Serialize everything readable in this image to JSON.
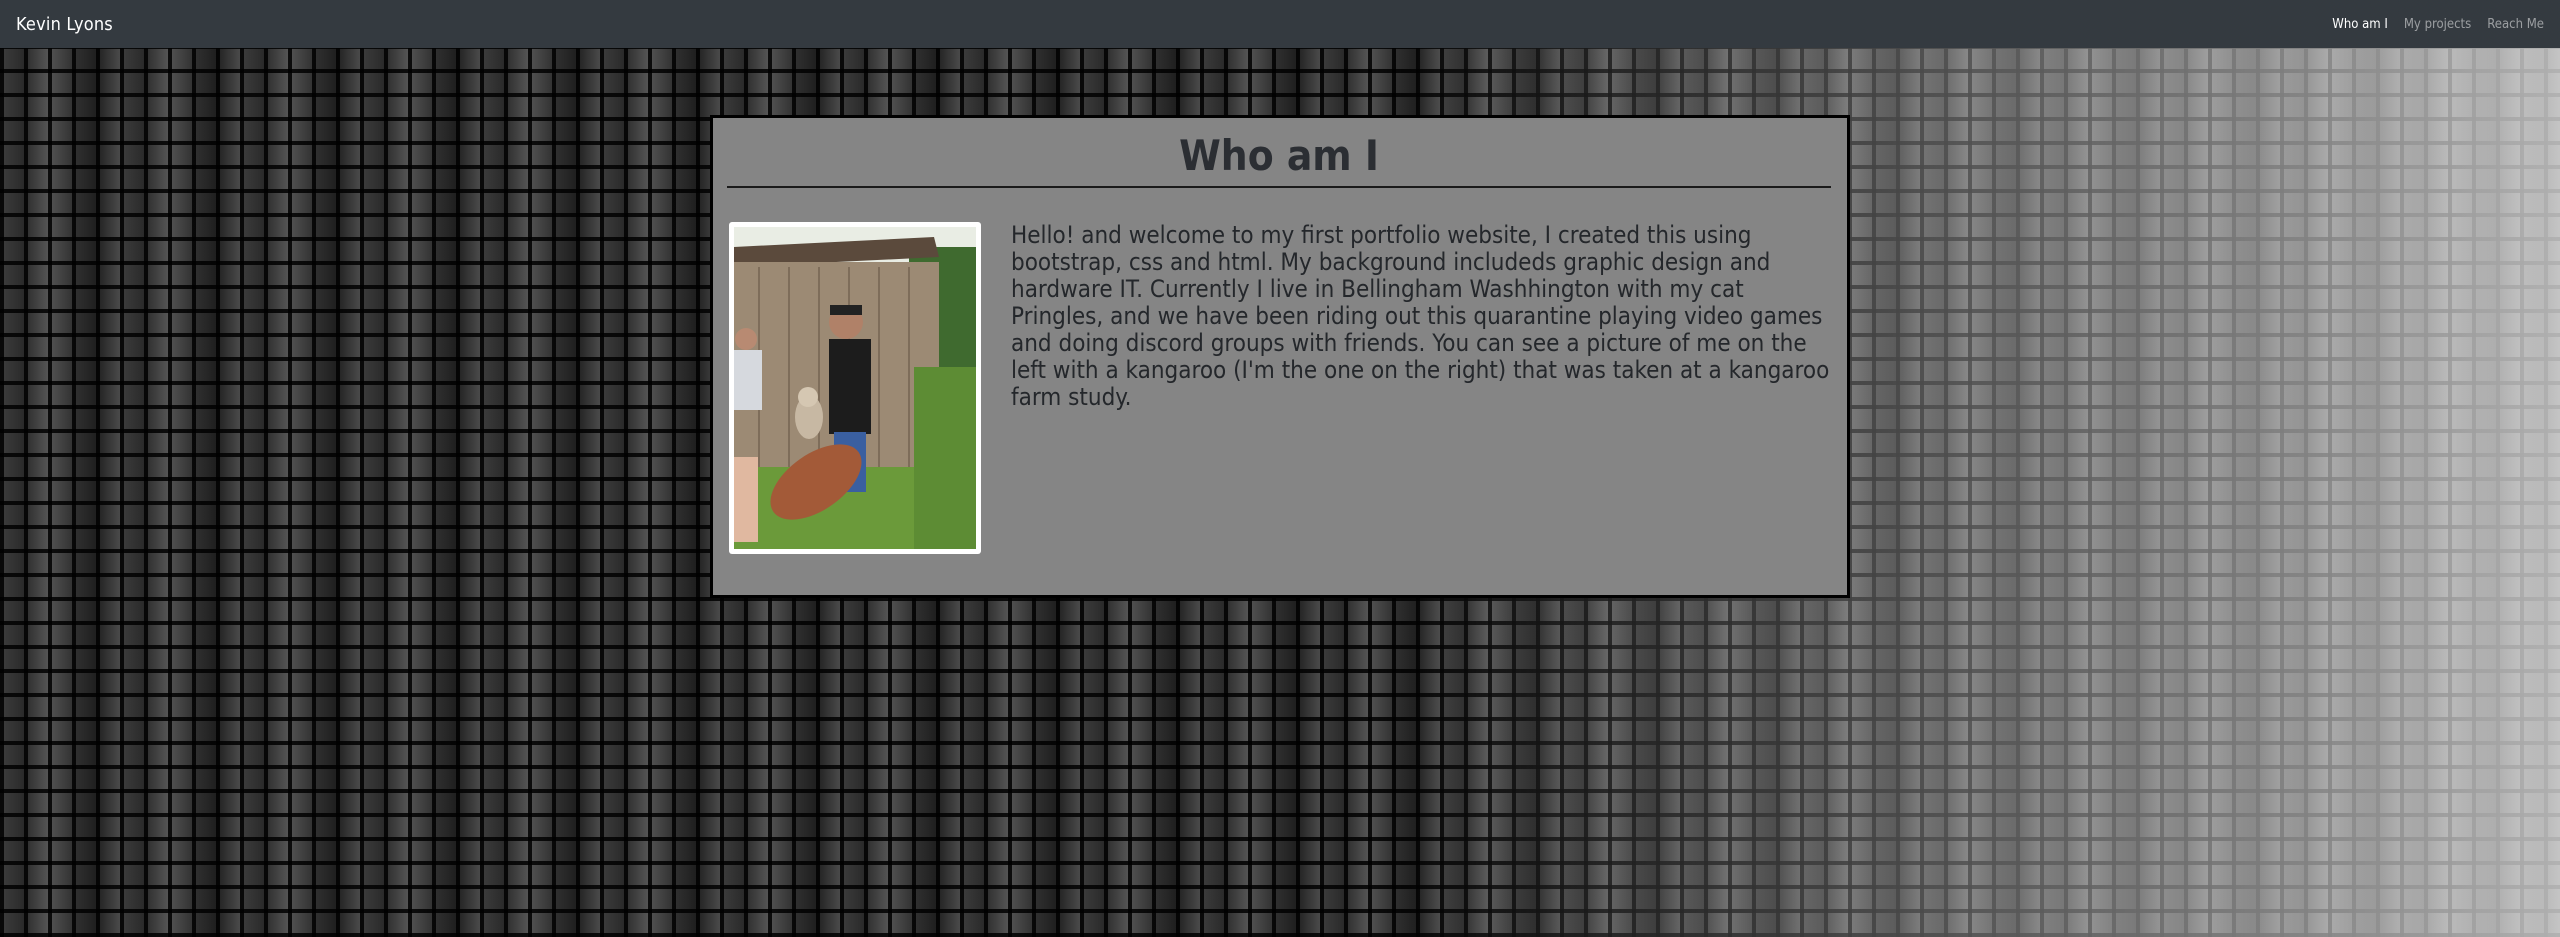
{
  "navbar": {
    "brand": "Kevin Lyons",
    "links": [
      {
        "label": "Who am I",
        "active": true
      },
      {
        "label": "My projects",
        "active": false
      },
      {
        "label": "Reach Me",
        "active": false
      }
    ]
  },
  "about": {
    "title": "Who am I",
    "bio": "Hello! and welcome to my first portfolio website, I created this using bootstrap, css and html. My background includeds graphic design and hardware IT. Currently I live in Bellingham Washhington with my cat Pringles, and we have been riding out this quarantine playing video games and doing discord groups with friends. You can see a picture of me on the left with a kangaroo (I'm the one on the right) that was taken at a kangaroo farm study."
  },
  "colors": {
    "navbar_bg": "#343a40",
    "card_bg": "#858585",
    "title_color": "#2b2e33"
  }
}
